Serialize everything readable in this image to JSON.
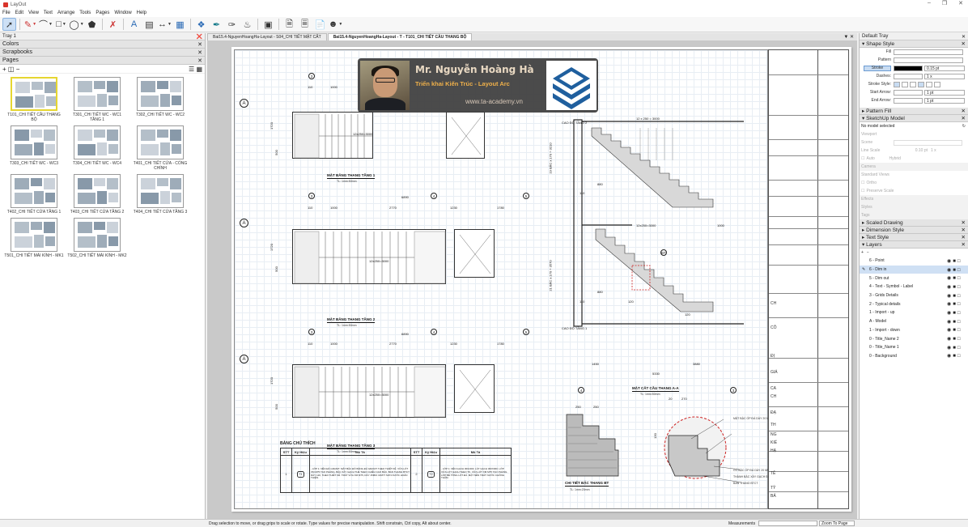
{
  "window": {
    "title": "LayOut"
  },
  "menu": [
    "File",
    "Edit",
    "View",
    "Text",
    "Arrange",
    "Tools",
    "Pages",
    "Window",
    "Help"
  ],
  "left_tray": {
    "title": "Tray 1",
    "sections": {
      "colors": "Colors",
      "scrapbooks": "Scrapbooks",
      "pages": "Pages"
    },
    "pages": [
      {
        "label": "T101_CHI TIẾT CẦU THANG BỘ",
        "selected": true
      },
      {
        "label": "T301_CHI TIẾT WC - WC1 TẦNG 1",
        "selected": false
      },
      {
        "label": "T302_CHI TIẾT WC - WC2",
        "selected": false
      },
      {
        "label": "T303_CHI TIẾT WC - WC3",
        "selected": false
      },
      {
        "label": "T304_CHI TIẾT WC - WC4",
        "selected": false
      },
      {
        "label": "T401_CHI TIẾT CỬA - CỔNG CHÍNH",
        "selected": false
      },
      {
        "label": "T402_CHI TIẾT CỬA TẦNG 1",
        "selected": false
      },
      {
        "label": "T403_CHI TIẾT CỬA TẦNG 2",
        "selected": false
      },
      {
        "label": "T404_CHI TIẾT CỬA TẦNG 3",
        "selected": false
      },
      {
        "label": "T501_CHI TIẾT MÁI KÍNH - MK1",
        "selected": false
      },
      {
        "label": "T502_CHI TIẾT MÁI KÍNH - MK2",
        "selected": false
      }
    ]
  },
  "doc_tabs": [
    {
      "label": "Bai15.4-NguyenHoangHa-Layout - S04_CHI TIẾT MẶT CẮT",
      "active": false
    },
    {
      "label": "Bai15.4-NguyenHoangHa-Layout - T - T101_CHI TIẾT CẦU THANG BỘ",
      "active": true
    }
  ],
  "drawing": {
    "plan1": "MẶT BẰNG THANG TẦNG 1",
    "plan2": "MẶT BẰNG THANG TẦNG 2",
    "plan3": "MẶT BẰNG THANG TẦNG 3",
    "section": "MẶT CẮT CẦU THANG A-A",
    "detail": "CHI TIẾT BẬC THANG BT",
    "scale": "TL: 1mm:50mm",
    "scale_detail": "TL: 1mm:20mm",
    "dims_top": [
      "110",
      "1000",
      "2770",
      "1230",
      "1780"
    ],
    "dim_total": "6890",
    "dims_left": [
      "1720",
      "500"
    ],
    "dims_left2": [
      "1720",
      "500"
    ],
    "dims_left3": [
      "1720",
      "500"
    ],
    "stair1": "12x250=3000",
    "stair2": "12x250=3000",
    "stair3": "12x250=3000",
    "sec_dims_bottom": [
      "1450",
      "3880"
    ],
    "sec_total": "5330",
    "sec_stairs_top": "12 x 250 = 3000",
    "sec_stairs_mid": "12x250=3000",
    "sec_left_top": "19 BẬC x 170 = 3210",
    "sec_left_bot": "21 BẬC x 170 = 3570",
    "sec_mid": [
      "880",
      "110",
      "880",
      "120",
      "120",
      "1000",
      "880",
      "110"
    ],
    "detail_dims": [
      "250",
      "250",
      "20",
      "270",
      "150",
      "130",
      "20"
    ],
    "bt_label": "BT",
    "levels": [
      "CAO ĐỘ TẦNG 2",
      "CAO ĐỘ TẦNG 1"
    ],
    "axes": [
      "3",
      "4",
      "5",
      "A"
    ],
    "notes": [
      "MẶT BẬC ỐP ĐÁ DÀY 20 MM",
      "CỔ BẬC ỐP ĐÁ DÀY 20 MM",
      "THÀNH BẬC XÂY GẠCH ĐẶC",
      "BẢN THANG BTCT"
    ],
    "legend": {
      "title": "BẢNG CHÚ THÍCH",
      "headers": [
        "STT",
        "Ký Hiệu",
        "Mô Tả",
        "STT",
        "Ký Hiệu",
        "Mô Tả"
      ],
      "row1": {
        "stt": "1",
        "sym": "T1",
        "desc": "- LỚP 1: NỀN ĐÁ GRANIT. MẶT BẬC ĐỔ BẰNG ĐÁ GRANIT THEO THIẾT KẾ. VỮA LÓT XM M75 TẠO PHẲNG. BẬC XÂY GẠCH THẺ THEO CHIỀU CAO BẬC. BẢN THANG BTCT DÀY 120, THEO THIẾT KẾ. TRÁT VỮA XM M75, DÀY 15MM. MATIT SƠN NƯỚC HOÀN THIỆN."
      },
      "row2": {
        "stt": "2",
        "sym": "T2",
        "desc": "- LỚP 1: NỀN GẠCH 300x300. LÁT GẠCH 300X300. LỚP VỮA LÓT GẠCH THEO TK. VỮA LÓT XM M75 TẠO PHẲNG. LỚP BÊ TÔNG LÓT ĐÁ. MẶT NỀN TRÁT NƯỚC CHỐNG THẤM."
      }
    },
    "title_block": [
      "CH",
      "CÔ",
      "ĐỊ",
      "GIÁ",
      "CA",
      "CH",
      "ĐẠ",
      "TH",
      "NG",
      "KIỂ",
      "HẠ",
      "TÊ",
      "TỶ",
      "BẢ"
    ]
  },
  "promo": {
    "name": "Mr. Nguyễn Hoàng Hà",
    "role": "Triển khai Kiến Trúc - Layout Arc",
    "site": "www.ta-academy.vn"
  },
  "right_tray": {
    "title": "Default Tray",
    "shape_style": "Shape Style",
    "fill_label": "Fill",
    "pattern_label": "Pattern",
    "stroke_label": "Stroke",
    "stroke_width": "0.15 pt",
    "dashes_label": "Dashes:",
    "dashes_value": "1 x",
    "stroke_style_label": "Stroke Style:",
    "start_arrow_label": "Start Arrow:",
    "end_arrow_label": "End Arrow:",
    "arrow_value": "1 pt",
    "pattern_fill": "Pattern Fill",
    "sketchup_model": "SketchUp Model",
    "no_model": "No model selected",
    "viewport": "Viewport",
    "scene": "Scene",
    "line_scale": "Line Scale",
    "line_scale_val": "0.10 pt",
    "line_scale_x": "1 x",
    "auto": "Auto",
    "hybrid": "Hybrid",
    "camera": "Camera",
    "standard_views": "Standard Views",
    "ortho": "Ortho",
    "preserve_scale": "Preserve Scale",
    "effects": "Effects",
    "styles": "Styles",
    "tags": "Tags",
    "scaled_drawing": "Scaled Drawing",
    "dimension_style": "Dimension Style",
    "text_style": "Text Style",
    "layers_title": "Layers",
    "layers": [
      {
        "name": "6 - Point",
        "selected": false
      },
      {
        "name": "6 - Dim in",
        "selected": true
      },
      {
        "name": "5 - Dim out",
        "selected": false
      },
      {
        "name": "4 - Text - Symbol - Label",
        "selected": false
      },
      {
        "name": "3 - Grids Details",
        "selected": false
      },
      {
        "name": "2 - Typical details",
        "selected": false
      },
      {
        "name": "1 - Import - up",
        "selected": false
      },
      {
        "name": "A - Model",
        "selected": false
      },
      {
        "name": "1 - Import - down",
        "selected": false
      },
      {
        "name": "0 - Title_Name 2",
        "selected": false
      },
      {
        "name": "0 - Title_Name 1",
        "selected": false
      },
      {
        "name": "0 - Background",
        "selected": false
      }
    ]
  },
  "status": {
    "message": "Drag selection to move, or drag grips to scale or rotate. Type values for precise manipulation. Shift constrain, Ctrl copy, Alt about center.",
    "measurements": "Measurements",
    "zoom": "Zoom To Page"
  },
  "colors": {
    "accent": "#cde0f5",
    "selected_page": "#e6d630",
    "promo_gold": "#efb04a",
    "logo_blue": "#1f5f9e"
  }
}
